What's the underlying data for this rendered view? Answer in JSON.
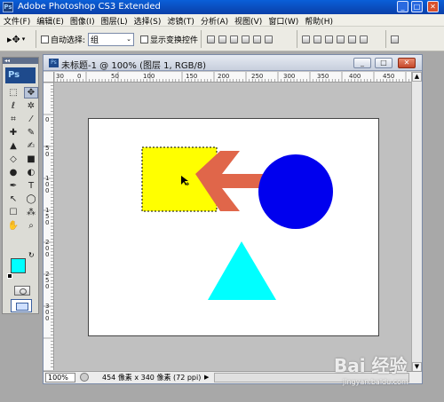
{
  "app": {
    "title": "Adobe Photoshop CS3 Extended",
    "logo": "Ps",
    "mini_logo": "Ps"
  },
  "window_controls": {
    "minimize": "_",
    "maximize": "□",
    "close": "✕"
  },
  "menu": [
    "文件(F)",
    "编辑(E)",
    "图像(I)",
    "图层(L)",
    "选择(S)",
    "滤镜(T)",
    "分析(A)",
    "视图(V)",
    "窗口(W)",
    "帮助(H)"
  ],
  "options_bar": {
    "tool_glyph": "▸✥",
    "auto_select_label": "自动选择:",
    "auto_select_value": "组",
    "show_transform_label": "显示变换控件"
  },
  "tools": {
    "grip": "◂◂",
    "items": [
      {
        "glyph": "⬚",
        "name": "marquee-tool-icon"
      },
      {
        "glyph": "✥",
        "name": "move-tool-icon",
        "active": true
      },
      {
        "glyph": "ℓ",
        "name": "lasso-tool-icon"
      },
      {
        "glyph": "✲",
        "name": "magic-wand-tool-icon"
      },
      {
        "glyph": "⌗",
        "name": "crop-tool-icon"
      },
      {
        "glyph": "⁄",
        "name": "slice-tool-icon"
      },
      {
        "glyph": "✚",
        "name": "healing-brush-tool-icon"
      },
      {
        "glyph": "✎",
        "name": "brush-tool-icon"
      },
      {
        "glyph": "▲",
        "name": "clone-stamp-tool-icon"
      },
      {
        "glyph": "✍",
        "name": "history-brush-tool-icon"
      },
      {
        "glyph": "◇",
        "name": "eraser-tool-icon"
      },
      {
        "glyph": "■",
        "name": "gradient-tool-icon"
      },
      {
        "glyph": "●",
        "name": "blur-tool-icon"
      },
      {
        "glyph": "◐",
        "name": "dodge-tool-icon"
      },
      {
        "glyph": "✒",
        "name": "pen-tool-icon"
      },
      {
        "glyph": "T",
        "name": "type-tool-icon"
      },
      {
        "glyph": "↖",
        "name": "path-selection-tool-icon"
      },
      {
        "glyph": "◯",
        "name": "shape-tool-icon"
      },
      {
        "glyph": "☐",
        "name": "notes-tool-icon"
      },
      {
        "glyph": "⁂",
        "name": "eyedropper-tool-icon"
      },
      {
        "glyph": "✋",
        "name": "hand-tool-icon"
      },
      {
        "glyph": "⌕",
        "name": "zoom-tool-icon"
      }
    ],
    "foreground_color": "#00FFFF",
    "background_color": "#FFFFFF",
    "swap_glyph": "↻"
  },
  "document": {
    "title": "未标题-1 @ 100% (图层 1, RGB/8)",
    "ruler_labels": [
      "30",
      "0",
      "50",
      "100",
      "150",
      "200",
      "250",
      "300",
      "350",
      "400",
      "450"
    ],
    "vruler_labels": [
      "0",
      "5",
      "0",
      "1",
      "0",
      "0",
      "1",
      "5",
      "0",
      "2",
      "0",
      "0",
      "2",
      "5",
      "0",
      "3",
      "0",
      "0"
    ],
    "zoom": "100%",
    "info": "454 像素 x 340 像素 (72 ppi)",
    "status_arrow": "▶",
    "scroll_up": "▲",
    "scroll_down": "▼"
  },
  "canvas_shapes": {
    "yellow_square": "#FFFF00",
    "arrow": "#E0664A",
    "circle": "#0000EE",
    "triangle": "#00FFFF"
  },
  "watermark": {
    "brand": "Bai 经验",
    "url": "jingyan.baidu.com"
  }
}
